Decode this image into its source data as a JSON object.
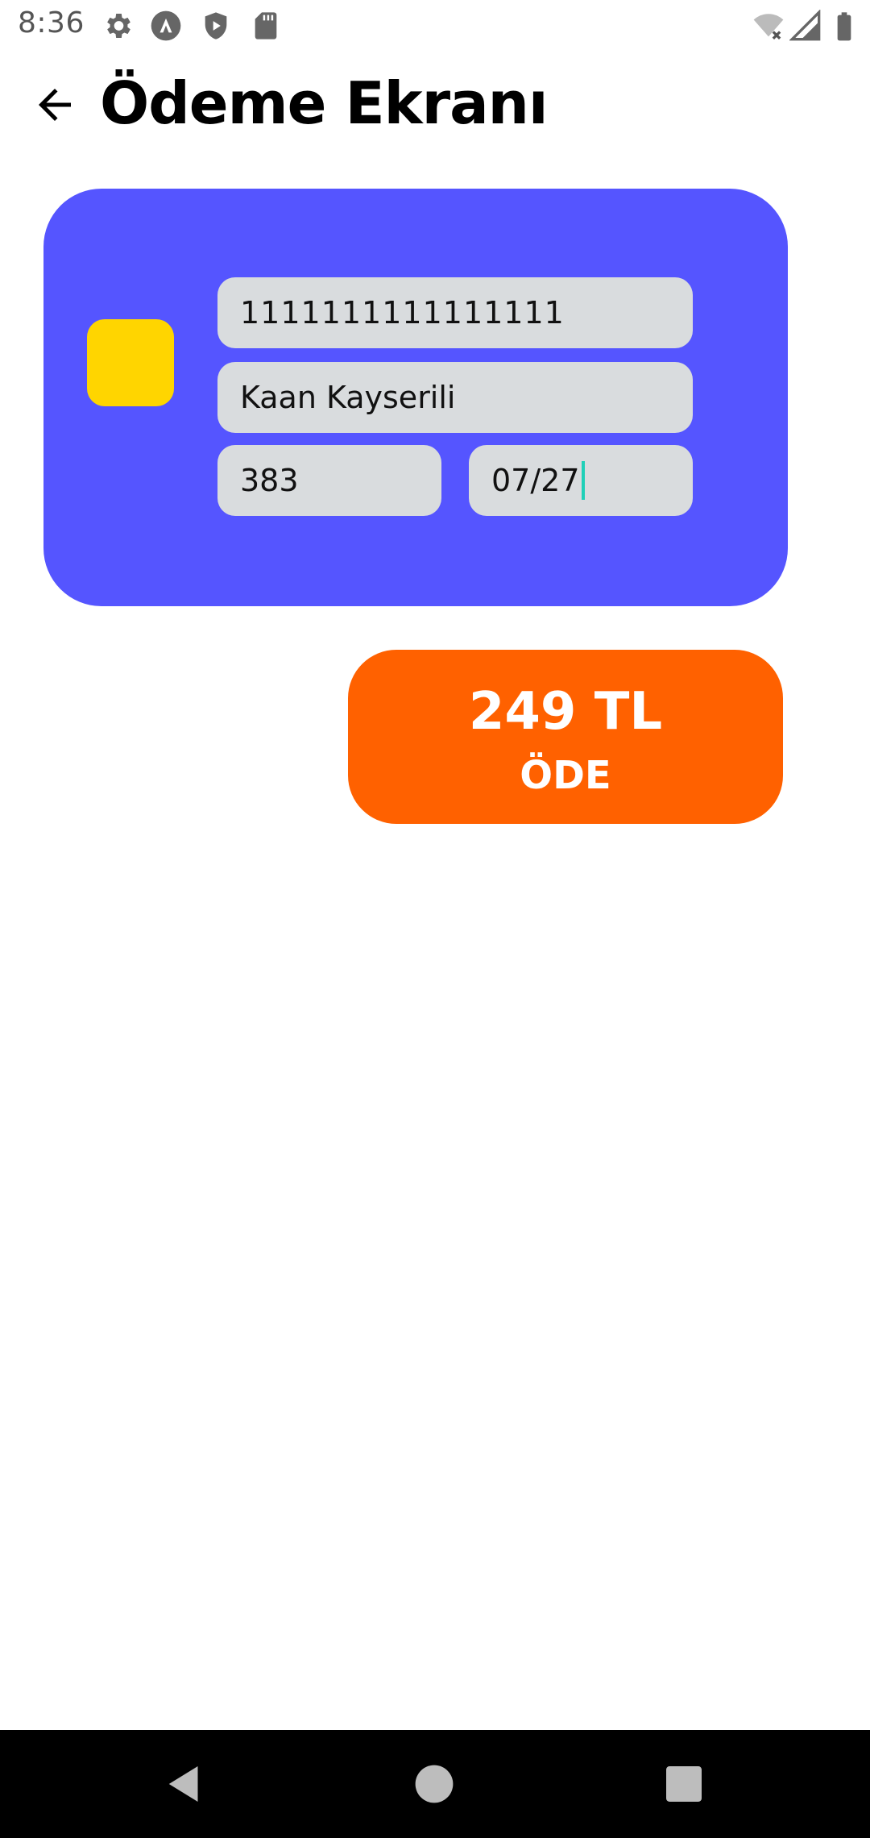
{
  "status_bar": {
    "time": "8:36",
    "left_icons": [
      "gear-icon",
      "app-a-icon",
      "shield-play-icon",
      "sd-card-icon"
    ],
    "right_icons": [
      "wifi-off-icon",
      "cell-signal-icon",
      "battery-icon"
    ]
  },
  "app_bar": {
    "title": "Ödeme Ekranı",
    "back_icon": "arrow-left-icon"
  },
  "card": {
    "color": "#5555ff",
    "chip_color": "#ffd500",
    "number": "1111111111111111",
    "holder_name": "Kaan Kayserili",
    "cvv": "383",
    "expiry": "07/27"
  },
  "pay_button": {
    "amount": "249 TL",
    "label": "ÖDE",
    "color": "#ff6100"
  },
  "nav_bar": {
    "items": [
      "back-icon",
      "home-icon",
      "recents-icon"
    ]
  }
}
